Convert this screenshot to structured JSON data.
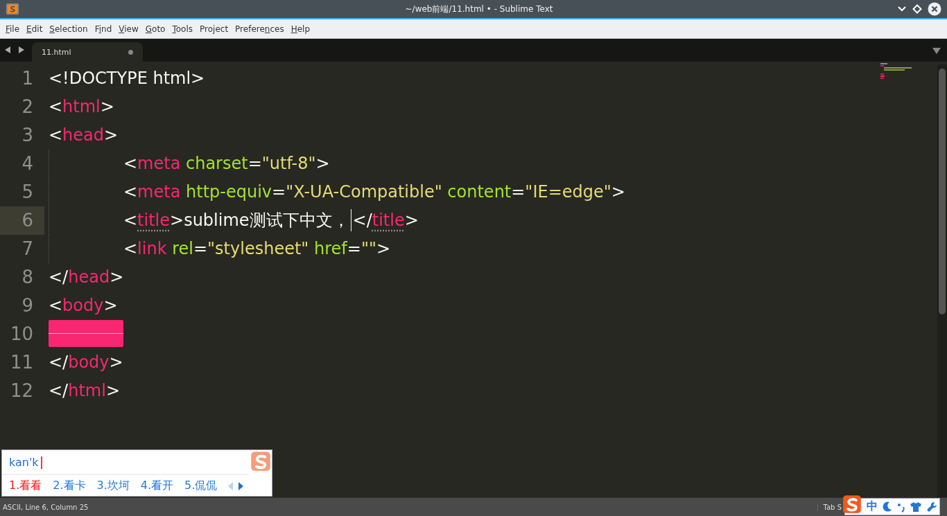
{
  "window": {
    "title": "~/web前端/11.html • - Sublime Text"
  },
  "menu": [
    {
      "key": "F",
      "rest": "ile"
    },
    {
      "key": "E",
      "rest": "dit"
    },
    {
      "key": "S",
      "rest": "election"
    },
    {
      "pre": "F",
      "key": "i",
      "rest": "nd"
    },
    {
      "key": "V",
      "rest": "iew"
    },
    {
      "key": "G",
      "rest": "oto"
    },
    {
      "key": "T",
      "rest": "ools"
    },
    {
      "pre": "Project"
    },
    {
      "pre": "Prefere",
      "key": "n",
      "rest": "ces"
    },
    {
      "key": "H",
      "rest": "elp"
    }
  ],
  "tabs": [
    {
      "label": "11.html",
      "selected": true,
      "modified": true
    }
  ],
  "editor": {
    "lines": [
      {
        "number": "1",
        "current": false,
        "indented": false,
        "error": false,
        "tokens": [
          {
            "kind": "punct",
            "t": "<!DOCTYPE html>"
          }
        ]
      },
      {
        "number": "2",
        "current": false,
        "indented": false,
        "error": false,
        "tokens": [
          {
            "kind": "punct",
            "t": "<"
          },
          {
            "kind": "tag",
            "t": "html"
          },
          {
            "kind": "punct",
            "t": ">"
          }
        ]
      },
      {
        "number": "3",
        "current": false,
        "indented": false,
        "error": false,
        "tokens": [
          {
            "kind": "punct",
            "t": "<"
          },
          {
            "kind": "tag",
            "t": "head"
          },
          {
            "kind": "punct",
            "t": ">"
          }
        ]
      },
      {
        "number": "4",
        "current": false,
        "indented": true,
        "error": false,
        "tokens": [
          {
            "kind": "punct",
            "t": "<"
          },
          {
            "kind": "tag",
            "t": "meta"
          },
          {
            "kind": "attr",
            "t": " charset"
          },
          {
            "kind": "punct",
            "t": "="
          },
          {
            "kind": "string",
            "t": "\"utf-8\""
          },
          {
            "kind": "punct",
            "t": ">"
          }
        ]
      },
      {
        "number": "5",
        "current": false,
        "indented": true,
        "error": false,
        "tokens": [
          {
            "kind": "punct",
            "t": "<"
          },
          {
            "kind": "tag",
            "t": "meta"
          },
          {
            "kind": "attr",
            "t": " http-equiv"
          },
          {
            "kind": "punct",
            "t": "="
          },
          {
            "kind": "string",
            "t": "\"X-UA-Compatible\""
          },
          {
            "kind": "attr",
            "t": " content"
          },
          {
            "kind": "punct",
            "t": "="
          },
          {
            "kind": "string",
            "t": "\"IE=edge\""
          },
          {
            "kind": "punct",
            "t": ">"
          }
        ]
      },
      {
        "number": "6",
        "current": true,
        "indented": true,
        "error": false,
        "tokens": [
          {
            "kind": "punct",
            "t": "<"
          },
          {
            "kind": "tag",
            "t": "title",
            "matched": true
          },
          {
            "kind": "punct",
            "t": ">sublime测试下中文，",
            "cursor": true
          },
          {
            "kind": "punct",
            "t": "</"
          },
          {
            "kind": "tag",
            "t": "title",
            "matched": true
          },
          {
            "kind": "punct",
            "t": ">"
          }
        ]
      },
      {
        "number": "7",
        "current": false,
        "indented": true,
        "error": false,
        "tokens": [
          {
            "kind": "punct",
            "t": "<"
          },
          {
            "kind": "tag",
            "t": "link"
          },
          {
            "kind": "attr",
            "t": " rel"
          },
          {
            "kind": "punct",
            "t": "="
          },
          {
            "kind": "string",
            "t": "\"stylesheet\""
          },
          {
            "kind": "attr",
            "t": " href"
          },
          {
            "kind": "punct",
            "t": "="
          },
          {
            "kind": "string",
            "t": "\"\""
          },
          {
            "kind": "punct",
            "t": ">"
          }
        ]
      },
      {
        "number": "8",
        "current": false,
        "indented": false,
        "error": false,
        "tokens": [
          {
            "kind": "punct",
            "t": "</"
          },
          {
            "kind": "tag",
            "t": "head"
          },
          {
            "kind": "punct",
            "t": ">"
          }
        ]
      },
      {
        "number": "9",
        "current": false,
        "indented": false,
        "error": false,
        "tokens": [
          {
            "kind": "punct",
            "t": "<"
          },
          {
            "kind": "tag",
            "t": "body"
          },
          {
            "kind": "punct",
            "t": ">"
          }
        ]
      },
      {
        "number": "10",
        "current": false,
        "indented": false,
        "error": true
      },
      {
        "number": "11",
        "current": false,
        "indented": false,
        "error": false,
        "tokens": [
          {
            "kind": "punct",
            "t": "</"
          },
          {
            "kind": "tag",
            "t": "body"
          },
          {
            "kind": "punct",
            "t": ">"
          }
        ]
      },
      {
        "number": "12",
        "current": false,
        "indented": false,
        "error": false,
        "tokens": [
          {
            "kind": "punct",
            "t": "</"
          },
          {
            "kind": "tag",
            "t": "html"
          },
          {
            "kind": "punct",
            "t": ">"
          }
        ]
      }
    ]
  },
  "ime": {
    "input": "kan'k",
    "candidates": [
      {
        "label": "1.看看",
        "selected": true
      },
      {
        "label": "2.看卡",
        "selected": false
      },
      {
        "label": "3.坎坷",
        "selected": false
      },
      {
        "label": "4.看开",
        "selected": false
      },
      {
        "label": "5.侃侃",
        "selected": false
      }
    ],
    "prev_enabled": false,
    "next_enabled": true
  },
  "status_bar": {
    "left": "ASCII, Line 6, Column 25",
    "right": "Tab S"
  },
  "ime_tray": {
    "mode": "中"
  }
}
